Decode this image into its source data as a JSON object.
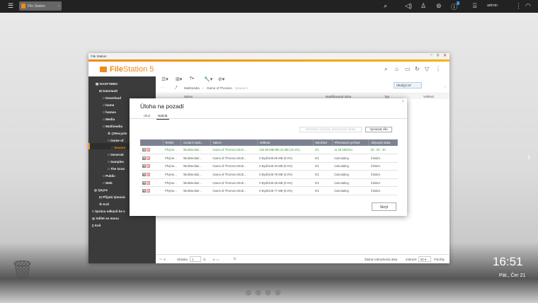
{
  "topbar": {
    "app_tab": "File Station",
    "user": "admin",
    "notification_count": "1"
  },
  "window": {
    "title": "File Station",
    "logo_main": "File",
    "logo_rest": "Station 5",
    "tooltip": "Úkol(y):10"
  },
  "sidebar": {
    "items": [
      {
        "label": "NASF7680C"
      },
      {
        "label": "DataVault"
      },
      {
        "label": "Download"
      },
      {
        "label": "home"
      },
      {
        "label": "homes"
      },
      {
        "label": "Media"
      },
      {
        "label": "Multimedia"
      },
      {
        "label": "@Recycle"
      },
      {
        "label": "Game of"
      },
      {
        "label": "Season"
      },
      {
        "label": "Generati"
      },
      {
        "label": "Samples"
      },
      {
        "label": "The Gran"
      },
      {
        "label": "Public"
      },
      {
        "label": "Web"
      },
      {
        "label": "Qsync"
      },
      {
        "label": "Přijatá týmová"
      },
      {
        "label": "Koš"
      },
      {
        "label": "Správa odkazů ke s"
      },
      {
        "label": "Sdílet se mnou"
      },
      {
        "label": "Koš"
      }
    ]
  },
  "breadcrumb": [
    "Multimedia",
    "Game of Thrones",
    "Season 1"
  ],
  "columns": {
    "name": "Název",
    "modified": "Modifikovaná doba",
    "type": "Typ",
    "size": "Velikost"
  },
  "pager": {
    "page_label": "Stránka",
    "page": "1",
    "of": "/1",
    "no_data": "Žádná zobrazitelná data",
    "show_label": "Zobrazit",
    "per_page": "50",
    "items_label": "Položky"
  },
  "dialog": {
    "title": "Úloha na pozadí",
    "tabs": [
      "Úkol",
      "Nahrát"
    ],
    "remove_done": "Odstranit všechny dokončené úlohy",
    "clear_all": "Vymazat vše",
    "hide": "Skrýt",
    "headers": [
      "Režim",
      "Cesta k soub...",
      "Název",
      "Velikost",
      "Množství",
      "Přenosová rychlost",
      "Zbývající doba"
    ],
    "rows": [
      [
        "Přejme...",
        "/Multimedia/...",
        "Game.of.Thrones.S01E...",
        "160.88 MB/499.32 MB (32.2%)",
        "0/1",
        "11.29 MB/Sec.",
        "00 : 00 : 30"
      ],
      [
        "Přejme...",
        "/Multimedia/...",
        "Game.of.Thrones.S01E...",
        "0 Bytů/449.69 MB (0.0%)",
        "0/1",
        "Calculating",
        "Čekám"
      ],
      [
        "Přejme...",
        "/Multimedia/...",
        "Game.of.Thrones.S01E...",
        "0 Bytů/449.40 MB (0.0%)",
        "0/1",
        "Calculating",
        "Čekám"
      ],
      [
        "Přejme...",
        "/Multimedia/...",
        "Game.of.Thrones.S01E...",
        "0 Bytů/449.78 MB (0.0%)",
        "0/1",
        "Calculating",
        "Čekám"
      ],
      [
        "Přejme...",
        "/Multimedia/...",
        "Game.of.Thrones.S01E...",
        "0 Bytů/449.49 MB (0.0%)",
        "0/1",
        "Calculating",
        "Čekám"
      ],
      [
        "Přejme...",
        "/Multimedia/...",
        "Game.of.Thrones.S01E...",
        "0 Bytů/449.77 MB (0.0%)",
        "0/1",
        "Calculating",
        "Čekám"
      ]
    ]
  },
  "desktop": {
    "time": "16:51",
    "date": "Pát., Čer 21"
  }
}
